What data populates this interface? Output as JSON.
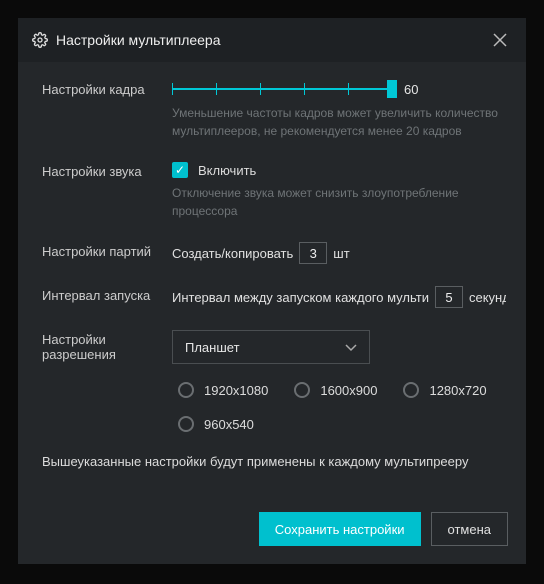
{
  "title": "Настройки мультиплеера",
  "rows": {
    "frame": {
      "label": "Настройки кадра",
      "value": "60",
      "hint": "Уменьшение частоты кадров может увеличить количество мультиплееров, не рекомендуется менее 20 кадров"
    },
    "sound": {
      "label": "Настройки звука",
      "enable": "Включить",
      "hint": "Отключение звука может снизить злоупотребление процессора"
    },
    "batch": {
      "label": "Настройки партий",
      "prefix": "Создать/копировать",
      "value": "3",
      "suffix": "шт"
    },
    "interval": {
      "label": "Интервал запуска",
      "prefix": "Интервал между запуском каждого мульти",
      "value": "5",
      "suffix": "секунд"
    },
    "resolution": {
      "label": "Настройки разрешения",
      "selected": "Планшет",
      "options": [
        "1920x1080",
        "1600x900",
        "1280x720",
        "960x540"
      ]
    }
  },
  "note": "Вышеуказанные настройки будут применены к каждому мультипрееру",
  "buttons": {
    "save": "Сохранить настройки",
    "cancel": "отмена"
  },
  "slider": {
    "min": 0,
    "max": 60,
    "ticks": 6
  }
}
